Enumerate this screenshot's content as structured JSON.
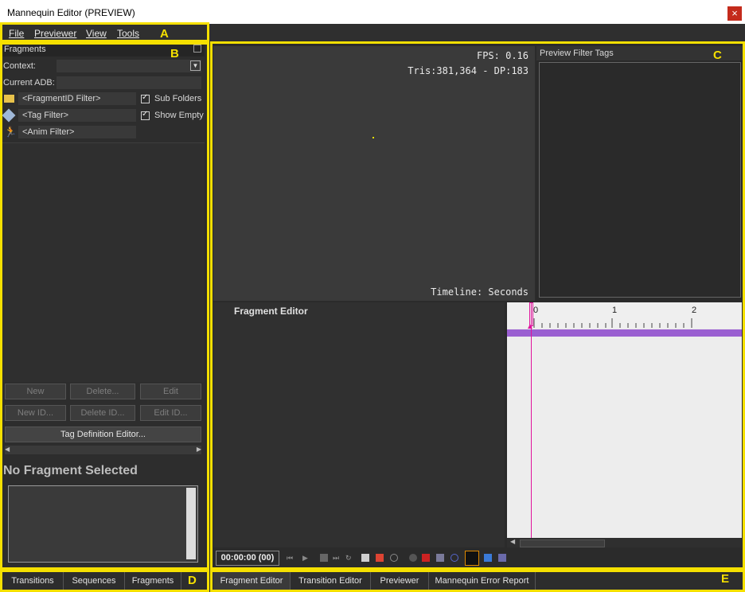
{
  "window": {
    "title": "Mannequin Editor (PREVIEW)",
    "close": "×"
  },
  "menu": [
    "File",
    "Previewer",
    "View",
    "Tools"
  ],
  "annotations": [
    "A",
    "B",
    "C",
    "D",
    "E"
  ],
  "fragments_panel": {
    "header": "Fragments",
    "context_label": "Context:",
    "current_adb_label": "Current ADB:",
    "fragment_filter": "<FragmentID Filter>",
    "tag_filter": "<Tag Filter>",
    "anim_filter": "<Anim Filter>",
    "sub_folders": "Sub Folders",
    "show_empty": "Show Empty",
    "buttons": {
      "new": "New",
      "delete": "Delete...",
      "edit": "Edit",
      "new_id": "New ID...",
      "delete_id": "Delete ID...",
      "edit_id": "Edit ID...",
      "tag_def": "Tag Definition Editor..."
    },
    "no_selection": "No Fragment Selected"
  },
  "left_tabs": [
    "Transitions",
    "Sequences",
    "Fragments"
  ],
  "viewport": {
    "fps": "FPS: 0.16",
    "tris": "Tris:381,364 - DP:183",
    "timeline_label": "Timeline: Seconds"
  },
  "preview_filter_tags": {
    "title": "Preview Filter Tags"
  },
  "fragment_editor": {
    "title": "Fragment Editor"
  },
  "timeline": {
    "ticks": [
      "0",
      "1",
      "2"
    ],
    "time": "00:00:00 (00)"
  },
  "right_tabs": [
    "Fragment Editor",
    "Transition Editor",
    "Previewer",
    "Mannequin Error Report"
  ],
  "colors": {
    "annotation": "#f5e000",
    "playhead": "#e0139c",
    "track": "#9a5fd1"
  }
}
